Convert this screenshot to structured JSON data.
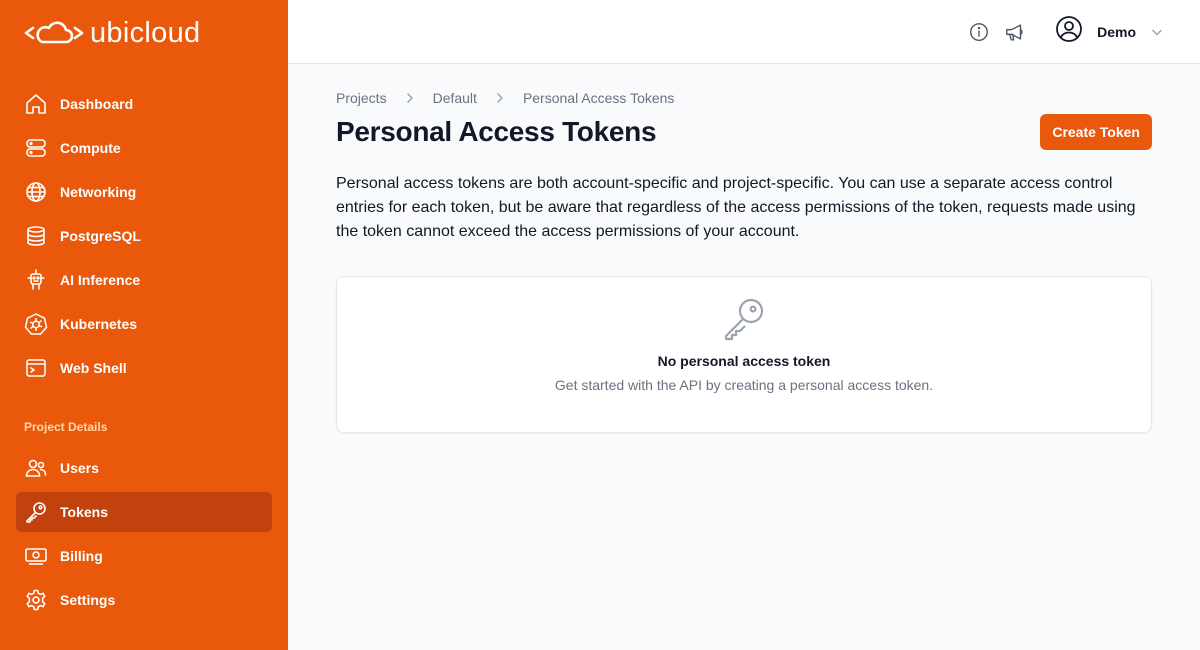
{
  "brand": {
    "name": "ubicloud"
  },
  "sidebar": {
    "items": [
      {
        "label": "Dashboard",
        "icon": "home-icon"
      },
      {
        "label": "Compute",
        "icon": "server-icon"
      },
      {
        "label": "Networking",
        "icon": "globe-icon"
      },
      {
        "label": "PostgreSQL",
        "icon": "database-icon"
      },
      {
        "label": "AI Inference",
        "icon": "cpu-robot-icon"
      },
      {
        "label": "Kubernetes",
        "icon": "kubernetes-icon"
      },
      {
        "label": "Web Shell",
        "icon": "terminal-icon"
      }
    ],
    "section_title": "Project Details",
    "project_items": [
      {
        "label": "Users",
        "icon": "users-icon"
      },
      {
        "label": "Tokens",
        "icon": "key-icon",
        "active": true
      },
      {
        "label": "Billing",
        "icon": "banknote-icon"
      },
      {
        "label": "Settings",
        "icon": "gear-icon"
      }
    ]
  },
  "topbar": {
    "user_name": "Demo"
  },
  "breadcrumb": [
    "Projects",
    "Default",
    "Personal Access Tokens"
  ],
  "page": {
    "title": "Personal Access Tokens",
    "create_label": "Create Token",
    "description": "Personal access tokens are both account-specific and project-specific. You can use a separate access control entries for each token, but be aware that regardless of the access permissions of the token, requests made using the token cannot exceed the access permissions of your account."
  },
  "empty_state": {
    "title": "No personal access token",
    "subtitle": "Get started with the API by creating a personal access token."
  },
  "colors": {
    "brand": "#ea580c",
    "active": "#c2410c"
  }
}
